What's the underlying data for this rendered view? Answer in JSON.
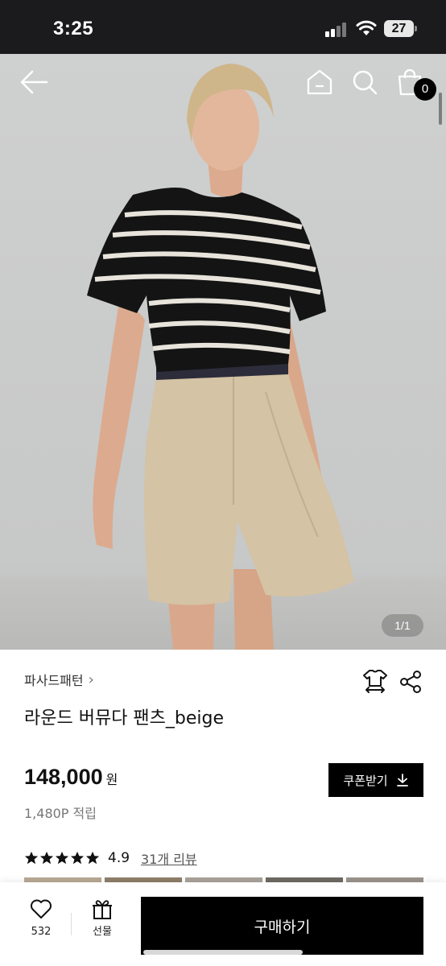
{
  "status_bar": {
    "time": "3:25",
    "battery": "27"
  },
  "nav": {
    "cart_count": "0"
  },
  "hero": {
    "page_indicator": "1/1"
  },
  "product": {
    "brand": "파사드패턴",
    "title": "라운드 버뮤다 팬츠_beige",
    "price": "148,000",
    "currency": "원",
    "points": "1,480P 적립",
    "coupon_label": "쿠폰받기",
    "rating": "4.9",
    "stars": 5,
    "review_link": "31개 리뷰"
  },
  "bottom_bar": {
    "like_count": "532",
    "gift_label": "선물",
    "buy_label": "구매하기"
  },
  "colors": {
    "accent": "#000000",
    "star": "#111111",
    "status_bar_bg": "#1b1b1d"
  }
}
